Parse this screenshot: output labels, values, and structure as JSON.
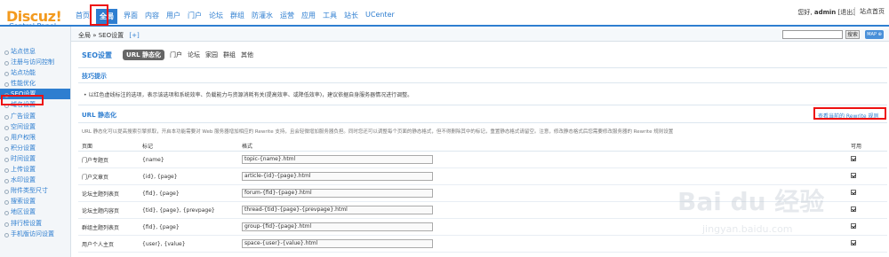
{
  "header": {
    "logo": "Discuz!",
    "logo_sub": "Control Panel",
    "nav": [
      "首页",
      "全局",
      "界面",
      "内容",
      "用户",
      "门户",
      "论坛",
      "群组",
      "防灌水",
      "运营",
      "应用",
      "工具",
      "站长",
      "UCenter"
    ],
    "active_nav": "全局",
    "greeting": "您好,",
    "username": "admin",
    "logout": "[退出]",
    "site_home": "站点首页"
  },
  "sidebar": {
    "items": [
      "站点信息",
      "注册与访问控制",
      "站点功能",
      "性能优化",
      "SEO设置",
      "域名设置",
      "广告设置",
      "空间设置",
      "用户权限",
      "积分设置",
      "时间设置",
      "上传设置",
      "水印设置",
      "附件类型尺寸",
      "搜索设置",
      "地区设置",
      "排行榜设置",
      "手机版访问设置"
    ],
    "active": "SEO设置"
  },
  "breadcrumb": {
    "text": "全局 » SEO设置",
    "plus": "[+]",
    "search_button": "搜索",
    "map_button": "MAP ⊕"
  },
  "tabs": {
    "title": "SEO设置",
    "items": [
      "URL 静态化",
      "门户",
      "论坛",
      "家园",
      "群组",
      "其他"
    ],
    "active": "URL 静态化"
  },
  "tips": {
    "heading": "技巧提示",
    "text": "• 以红色虚线标注的选项，表示该选项和系统效率、负载能力与资源消耗有关(提高效率、或降低效率)，建议依据自身服务器情况进行调整。"
  },
  "section": {
    "title": "URL 静态化",
    "rewrite_link": "查看当前的 Rewrite 规则",
    "description": "URL 静态化可以提高搜索引擎抓取，开启本功能需要对 Web 服务器增加相应的 Rewrite 支持，且会轻微增加服务器负担。同时您还可以调整每个页面的静态格式，但不得删除其中的标记，重置静态格式请留空。注意，修改静态格式后您需要修改服务器的 Rewrite 规则设置"
  },
  "table": {
    "headers": [
      "页面",
      "标记",
      "格式",
      "可用"
    ],
    "rows": [
      {
        "page": "门户专题页",
        "tags": "{name}",
        "format": "topic-{name}.html",
        "enabled": true
      },
      {
        "page": "门户文章页",
        "tags": "{id}, {page}",
        "format": "article-{id}-{page}.html",
        "enabled": true
      },
      {
        "page": "论坛主题列表页",
        "tags": "{fid}, {page}",
        "format": "forum-{fid}-{page}.html",
        "enabled": true
      },
      {
        "page": "论坛主题内容页",
        "tags": "{tid}, {page}, {prevpage}",
        "format": "thread-{tid}-{page}-{prevpage}.html",
        "enabled": true
      },
      {
        "page": "群组主题列表页",
        "tags": "{fid}, {page}",
        "format": "group-{fid}-{page}.html",
        "enabled": true
      },
      {
        "page": "用户个人主页",
        "tags": "{user}, {value}",
        "format": "space-{user}-{value}.html",
        "enabled": true
      }
    ]
  },
  "watermark": {
    "text": "Bai du 经验",
    "sub": "jingyan.baidu.com"
  },
  "colors": {
    "accent": "#2e7ed0",
    "logo": "#f39a1e",
    "highlight": "#e11111"
  }
}
